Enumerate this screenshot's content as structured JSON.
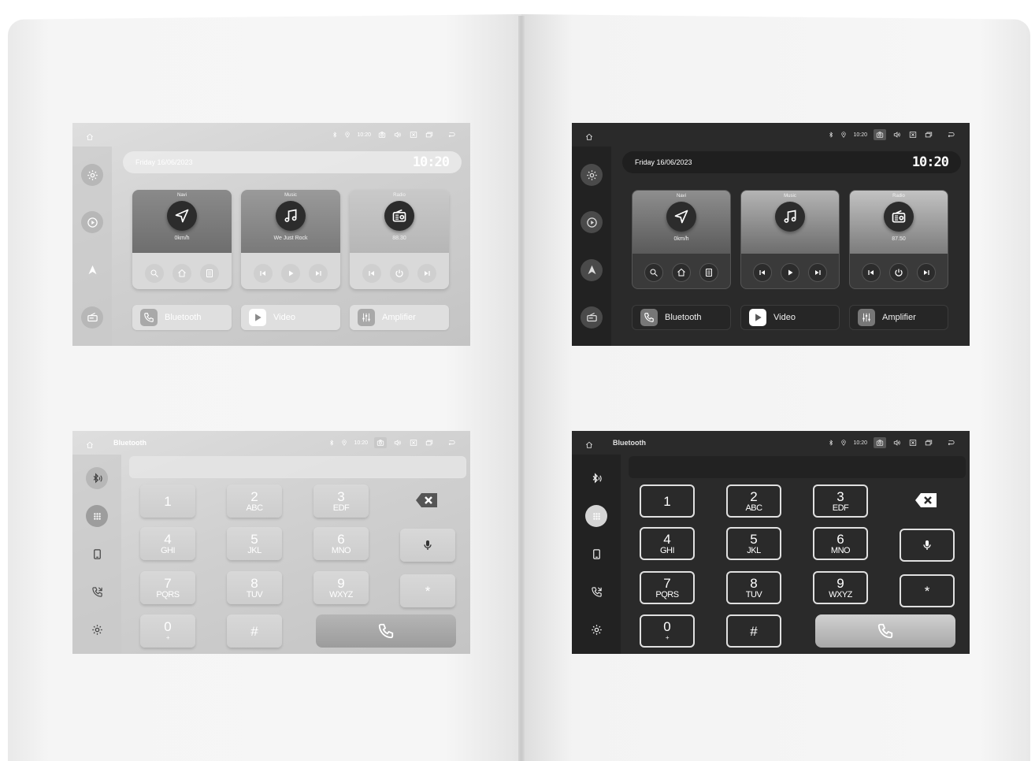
{
  "screens": {
    "home_light": {
      "date": "Friday 16/06/2023",
      "clock": "10:20",
      "status_time": "10:20",
      "cards": {
        "navi": {
          "label": "Navi",
          "sub": "0km/h"
        },
        "music": {
          "label": "Music",
          "sub": "We Just Rock"
        },
        "radio": {
          "label": "Radio",
          "sub": "88.30"
        }
      },
      "apps": {
        "bluetooth": "Bluetooth",
        "video": "Video",
        "amplifier": "Amplifier"
      }
    },
    "home_dark": {
      "date": "Friday 16/06/2023",
      "clock": "10:20",
      "status_time": "10:20",
      "cards": {
        "navi": {
          "label": "Navi",
          "sub": "0km/h"
        },
        "music": {
          "label": "Music",
          "sub": ""
        },
        "radio": {
          "label": "Radio",
          "sub": "87.50"
        }
      },
      "apps": {
        "bluetooth": "Bluetooth",
        "video": "Video",
        "amplifier": "Amplifier"
      }
    },
    "dialer_light": {
      "title": "Bluetooth",
      "status_time": "10:20"
    },
    "dialer_dark": {
      "title": "Bluetooth",
      "status_time": "10:20"
    }
  },
  "keypad": [
    {
      "digit": "1",
      "letters": ""
    },
    {
      "digit": "2",
      "letters": "ABC"
    },
    {
      "digit": "3",
      "letters": "EDF"
    },
    {
      "digit": "4",
      "letters": "GHI"
    },
    {
      "digit": "5",
      "letters": "JKL"
    },
    {
      "digit": "6",
      "letters": "MNO"
    },
    {
      "digit": "7",
      "letters": "PQRS"
    },
    {
      "digit": "8",
      "letters": "TUV"
    },
    {
      "digit": "9",
      "letters": "WXYZ"
    },
    {
      "digit": "0",
      "letters": "+"
    },
    {
      "digit": "#",
      "letters": ""
    },
    {
      "digit": "*",
      "letters": ""
    }
  ],
  "icons": {
    "status": [
      "home-icon",
      "bluetooth-icon",
      "location-icon",
      "camera-icon",
      "volume-icon",
      "close-box-icon",
      "window-icon",
      "back-icon"
    ],
    "home_sidebar": [
      "settings-icon",
      "play-icon",
      "navigation-icon",
      "radio-icon"
    ],
    "dialer_sidebar": [
      "bluetooth-audio-icon",
      "dialpad-icon",
      "phone-device-icon",
      "call-log-icon",
      "settings-icon"
    ]
  }
}
